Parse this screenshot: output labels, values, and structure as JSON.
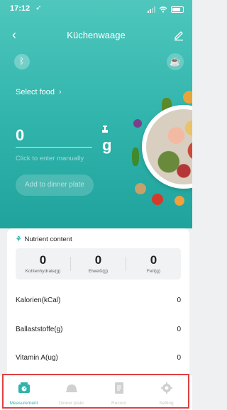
{
  "status_bar": {
    "time": "17:12",
    "location_glyph": "➶"
  },
  "header": {
    "back_label": "‹",
    "title": "Küchenwaage"
  },
  "scale": {
    "select_food_label": "Select food",
    "select_food_arrow": "›",
    "weight_value": "0",
    "unit": "g",
    "manual_entry_label": "Click to enter manually",
    "add_button_label": "Add to dinner plate"
  },
  "nutrients": {
    "section_title": "Nutrient content",
    "macros": [
      {
        "value": "0",
        "label": "Kohlenhydrate(g)"
      },
      {
        "value": "0",
        "label": "Eiweiß(g)"
      },
      {
        "value": "0",
        "label": "Fett(g)"
      }
    ],
    "rows": [
      {
        "label": "Kalorien(kCal)",
        "value": "0"
      },
      {
        "label": "Ballaststoffe(g)",
        "value": "0"
      },
      {
        "label": "Vitamin A(ug)",
        "value": "0"
      }
    ]
  },
  "tabs": [
    {
      "label": "Measurement",
      "icon": "scale-icon",
      "active": true
    },
    {
      "label": "Dinner plate",
      "icon": "cloche-icon",
      "active": false
    },
    {
      "label": "Record",
      "icon": "document-icon",
      "active": false
    },
    {
      "label": "Setting",
      "icon": "gear-icon",
      "active": false
    }
  ],
  "colors": {
    "accent": "#2fb3ab",
    "highlight": "#e04040"
  }
}
